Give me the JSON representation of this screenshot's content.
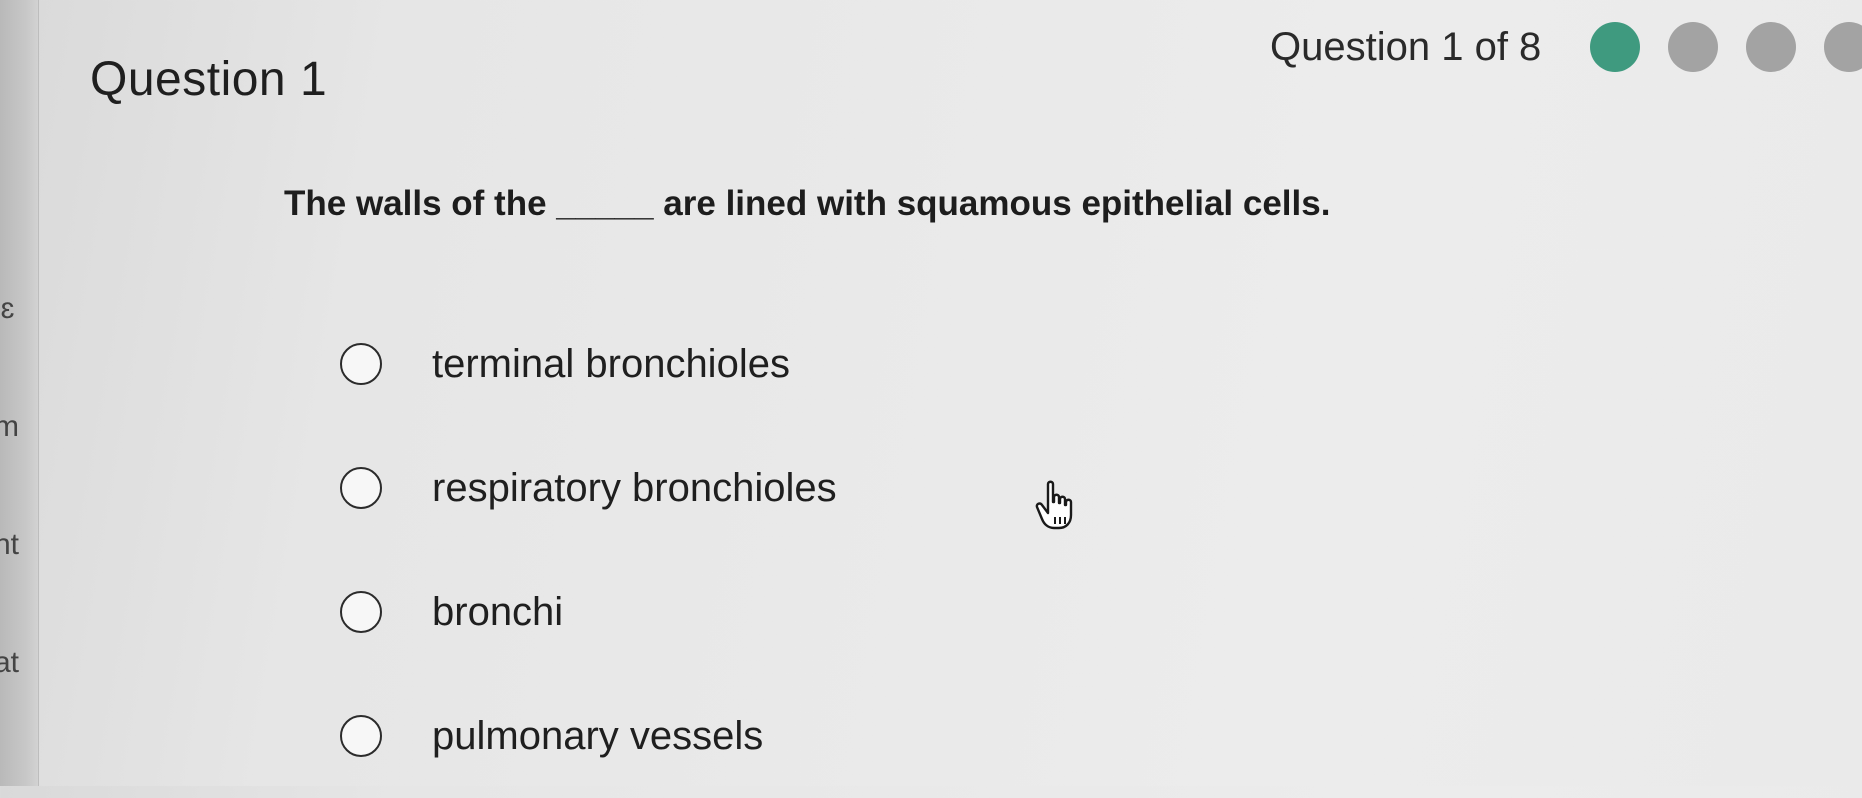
{
  "edge_text": [
    "lɛ",
    "m",
    "nt",
    "at"
  ],
  "question": {
    "title": "Question 1",
    "progress_label": "Question 1 of 8",
    "progress_dots": [
      "current",
      "pending",
      "pending",
      "pending"
    ],
    "prompt": "The walls of the _____ are lined with squamous epithelial cells."
  },
  "options": [
    "terminal bronchioles",
    "respiratory bronchioles",
    "bronchi",
    "pulmonary vessels"
  ],
  "colors": {
    "current_dot": "#3f9a7f",
    "pending_dot": "#a3a3a3"
  },
  "cursor_icon": "hand-pointer-icon"
}
